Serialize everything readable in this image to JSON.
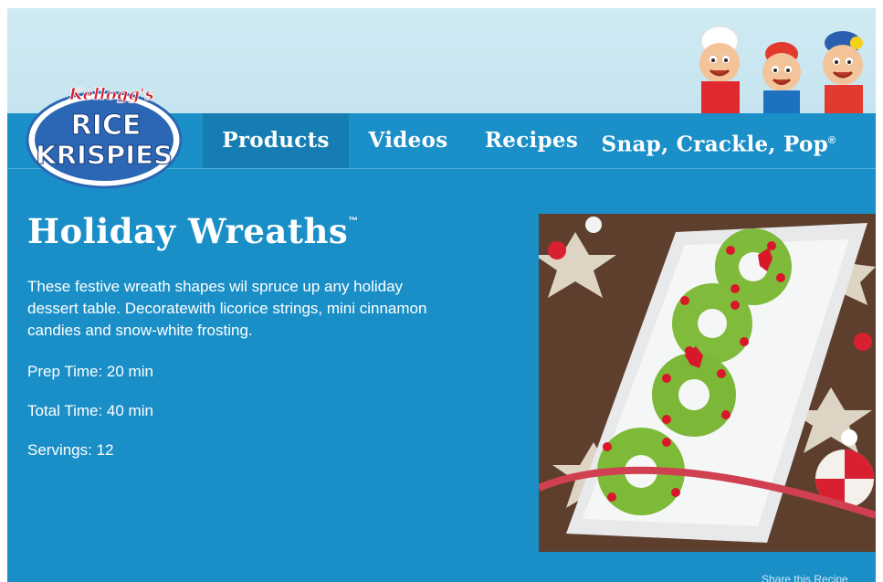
{
  "header": {
    "brand_top": "Kellogg's",
    "brand_line1": "RICE",
    "brand_line2": "KRISPIES",
    "characters_icon": "snap-crackle-pop-characters"
  },
  "nav": {
    "items": [
      {
        "label": "Products",
        "active": true
      },
      {
        "label": "Videos",
        "active": false
      },
      {
        "label": "Recipes",
        "active": false
      },
      {
        "label": "Snap, Crackle, Pop",
        "mark": "®",
        "active": false
      }
    ]
  },
  "recipe": {
    "title": "Holiday Wreaths",
    "title_mark": "™",
    "description": "These festive wreath shapes wil spruce up any holiday dessert table. Decoratewith licorice strings, mini cinnamon candies and snow-white frosting.",
    "prep_time": "Prep Time: 20 min",
    "total_time": "Total Time: 40 min",
    "servings": "Servings: 12",
    "share": "Share this Recipe"
  },
  "colors": {
    "background": "#1a8fc7",
    "sky": "#cfeaf3",
    "nav_active": "#157db2",
    "logo_blue": "#2b67b4",
    "logo_red": "#d02030",
    "wreath_green": "#7fba3a",
    "candy_red": "#d8182a"
  }
}
